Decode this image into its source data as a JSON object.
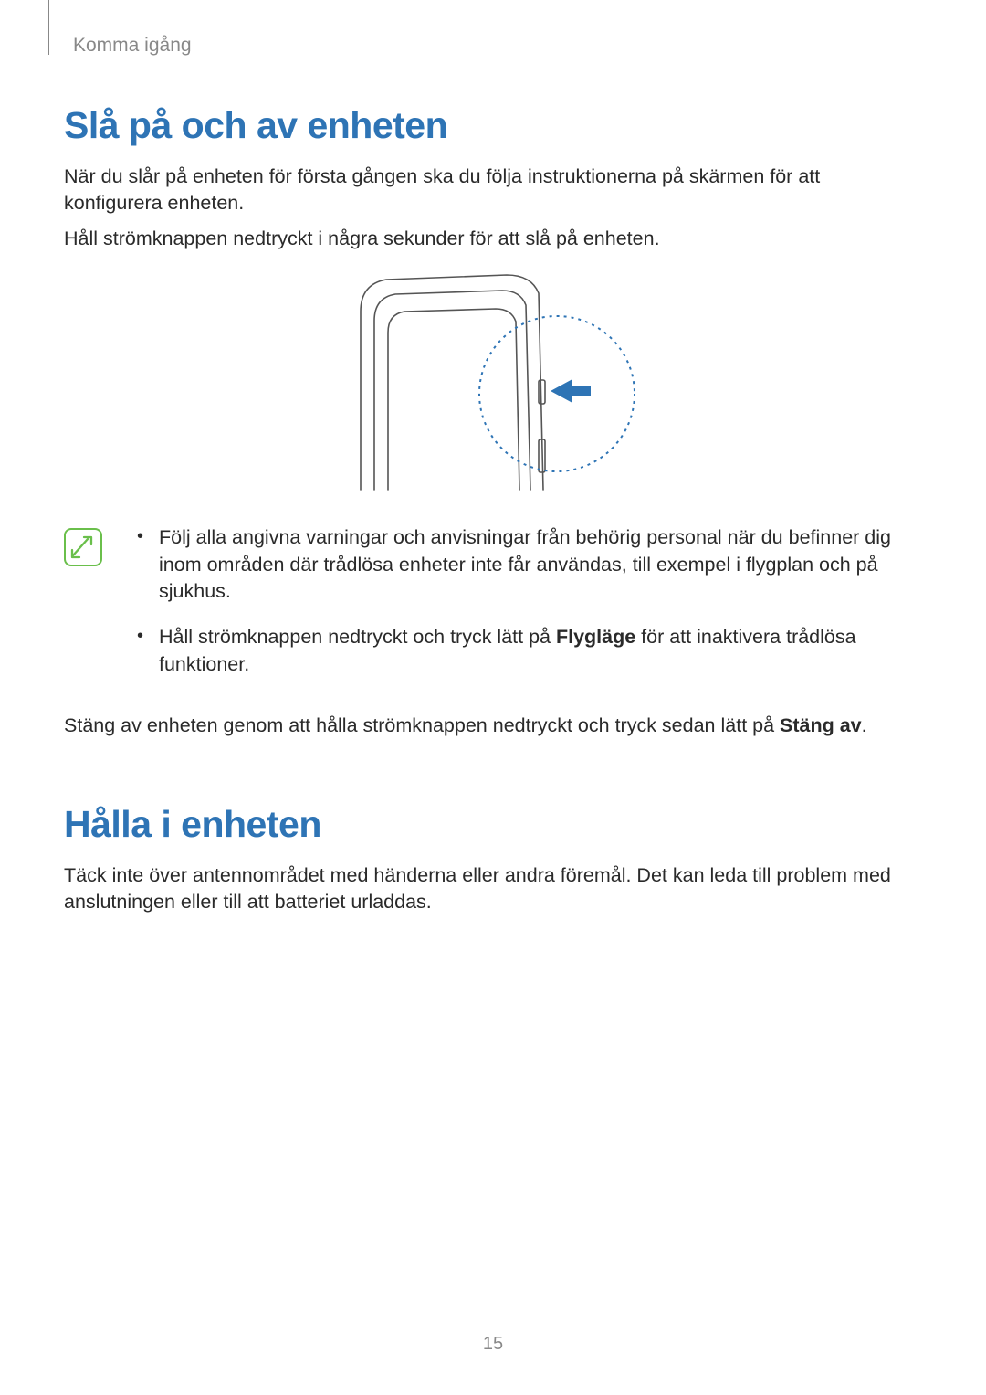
{
  "header": {
    "breadcrumb": "Komma igång"
  },
  "section1": {
    "title": "Slå på och av enheten",
    "p1": "När du slår på enheten för första gången ska du följa instruktionerna på skärmen för att konfigurera enheten.",
    "p2": "Håll strömknappen nedtryckt i några sekunder för att slå på enheten.",
    "bullets": {
      "b1": "Följ alla angivna varningar och anvisningar från behörig personal när du befinner dig inom områden där trådlösa enheter inte får användas, till exempel i flygplan och på sjukhus.",
      "b2_pre": "Håll strömknappen nedtryckt och tryck lätt på ",
      "b2_bold": "Flygläge",
      "b2_post": " för att inaktivera trådlösa funktioner."
    },
    "p3_pre": "Stäng av enheten genom att hålla strömknappen nedtryckt och tryck sedan lätt på ",
    "p3_bold": "Stäng av",
    "p3_post": "."
  },
  "section2": {
    "title": "Hålla i enheten",
    "p1": "Täck inte över antennområdet med händerna eller andra föremål. Det kan leda till problem med anslutningen eller till att batteriet urladdas."
  },
  "pageNumber": "15"
}
